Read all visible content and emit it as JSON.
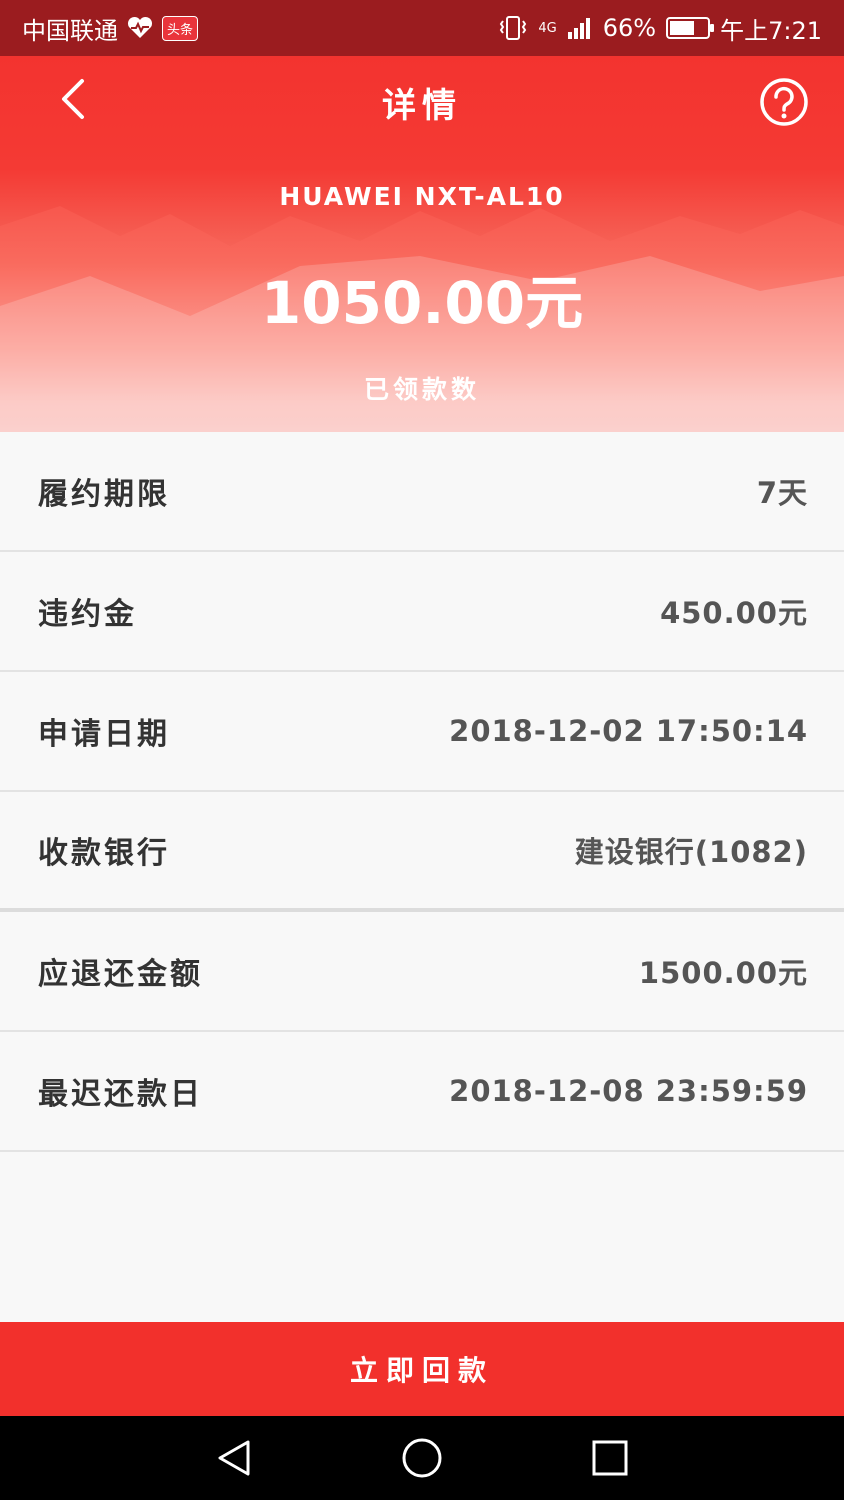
{
  "status_bar": {
    "carrier": "中国联通",
    "badge": "头条",
    "network": "4G",
    "battery_percent": "66%",
    "battery_level": 0.66,
    "time": "午上7:21"
  },
  "header": {
    "title": "详情",
    "device_name": "HUAWEI NXT-AL10",
    "amount": "1050.00元",
    "amount_label": "已领款数"
  },
  "details": {
    "rows": [
      {
        "label": "履约期限",
        "value": "7天"
      },
      {
        "label": "违约金",
        "value": "450.00元"
      },
      {
        "label": "申请日期",
        "value": "2018-12-02 17:50:14"
      },
      {
        "label": "收款银行",
        "value": "建设银行(1082)"
      },
      {
        "label": "应退还金额",
        "value": "1500.00元"
      },
      {
        "label": "最迟还款日",
        "value": "2018-12-08 23:59:59"
      }
    ]
  },
  "actions": {
    "repay_label": "立即回款"
  },
  "colors": {
    "brand_red": "#f2302c",
    "status_bar": "#9b1c1f"
  },
  "icons": {
    "back": "chevron-left-icon",
    "help": "question-circle-icon",
    "heart": "heart-pulse-icon",
    "vibrate": "vibrate-icon",
    "signal": "signal-icon",
    "battery": "battery-icon",
    "alarm": "alarm-icon",
    "nav_back": "triangle-back-icon",
    "nav_home": "circle-home-icon",
    "nav_recent": "square-recent-icon"
  }
}
